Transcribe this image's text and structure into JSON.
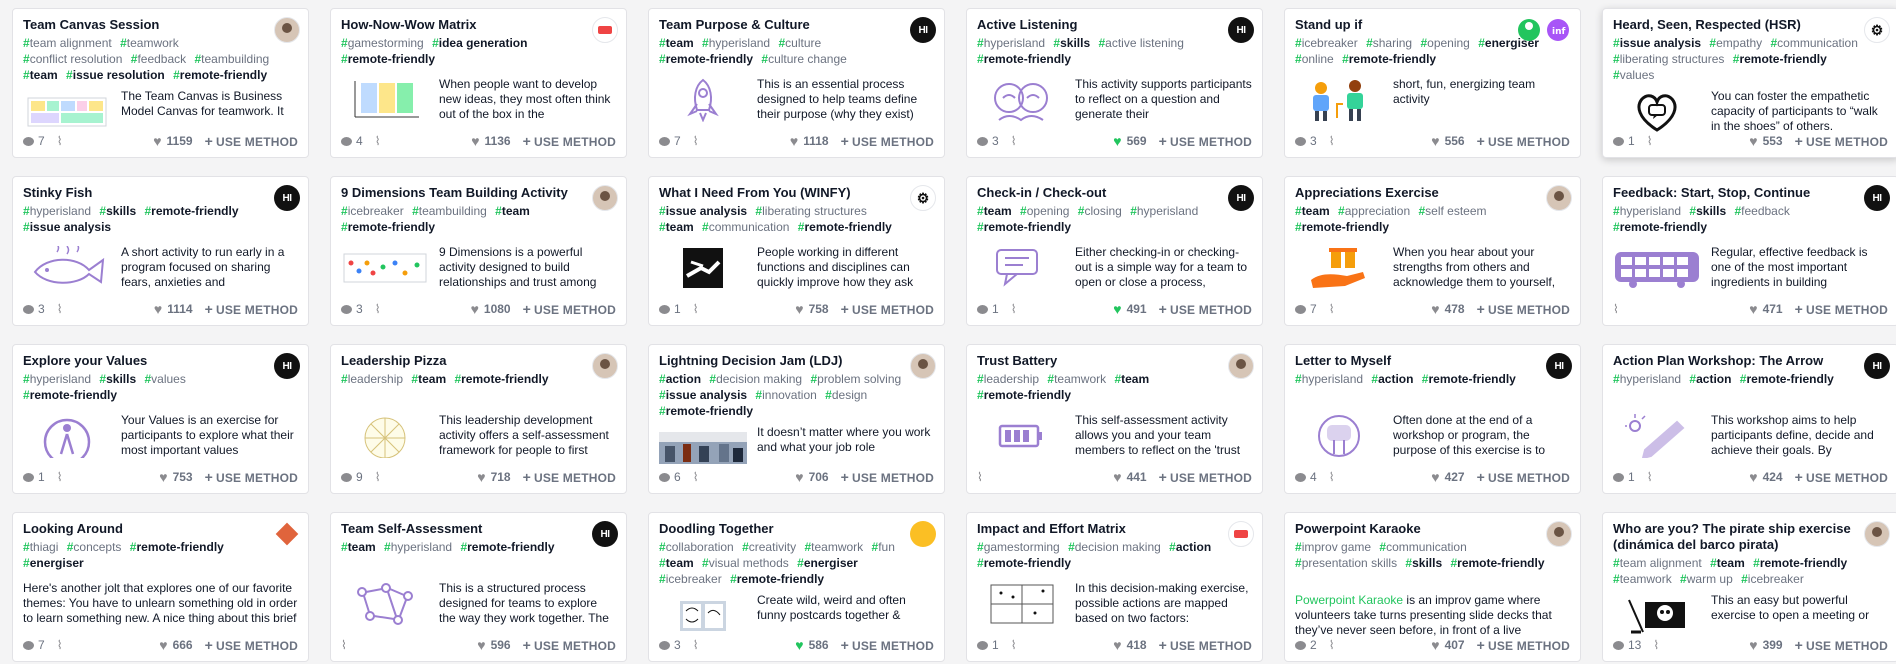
{
  "colors": {
    "accent": "#22c55e",
    "illustration": "#9b7fd1",
    "orange": "#f59e0b"
  },
  "cards": [
    {
      "title": "Team Canvas Session",
      "author": "person",
      "tags": [
        [
          "team alignment",
          0
        ],
        [
          "teamwork",
          0
        ],
        [
          "conflict resolution",
          0
        ],
        [
          "feedback",
          0
        ],
        [
          "teambuilding",
          0
        ],
        [
          "team",
          1
        ],
        [
          "issue resolution",
          1
        ],
        [
          "remote-friendly",
          1
        ]
      ],
      "desc": "The Team Canvas is Business Model Canvas for teamwork. It",
      "illus": "canvas-image",
      "comments": "7",
      "likes": "1159",
      "liked": false,
      "use": "USE METHOD"
    },
    {
      "title": "How-Now-Wow Matrix",
      "author": "badge",
      "tags": [
        [
          "gamestorming",
          0
        ],
        [
          "idea generation",
          1
        ],
        [
          "remote-friendly",
          1
        ]
      ],
      "desc": "When people want to develop new ideas, they most often think out of the box in the",
      "illus": "matrix-image",
      "comments": "4",
      "likes": "1136",
      "liked": false,
      "use": "USE METHOD"
    },
    {
      "title": "Team Purpose & Culture",
      "author": "hi",
      "tags": [
        [
          "team",
          1
        ],
        [
          "hyperisland",
          0
        ],
        [
          "culture",
          0
        ],
        [
          "remote-friendly",
          1
        ],
        [
          "culture change",
          0
        ]
      ],
      "desc": "This is an essential process designed to help teams define their purpose (why they exist)",
      "illus": "rocket-icon",
      "comments": "7",
      "likes": "1118",
      "liked": false,
      "use": "USE METHOD"
    },
    {
      "title": "Active Listening",
      "author": "hi",
      "tags": [
        [
          "hyperisland",
          0
        ],
        [
          "skills",
          1
        ],
        [
          "active listening",
          0
        ],
        [
          "remote-friendly",
          1
        ]
      ],
      "desc": "This activity supports participants to reflect on a question and generate their",
      "illus": "heads-icon",
      "comments": "3",
      "likes": "569",
      "liked": true,
      "use": "USE METHOD"
    },
    {
      "title": "Stand up if",
      "author": "logos",
      "tags": [
        [
          "icebreaker",
          0
        ],
        [
          "sharing",
          0
        ],
        [
          "opening",
          0
        ],
        [
          "energiser",
          1
        ],
        [
          "online",
          0
        ],
        [
          "remote-friendly",
          1
        ]
      ],
      "desc": "short, fun, energizing team activity",
      "illus": "people-icon",
      "comments": "3",
      "likes": "556",
      "liked": false,
      "use": "USE METHOD"
    },
    {
      "title": "Heard, Seen, Respected (HSR)",
      "author": "gift",
      "tags": [
        [
          "issue analysis",
          1
        ],
        [
          "empathy",
          0
        ],
        [
          "communication",
          0
        ],
        [
          "liberating structures",
          0
        ],
        [
          "remote-friendly",
          1
        ],
        [
          "values",
          0
        ]
      ],
      "desc": "You can foster the empathetic capacity of participants to “walk in the shoes” of others.",
      "illus": "heart-icon",
      "comments": "1",
      "likes": "553",
      "liked": false,
      "use": "USE METHOD"
    },
    {
      "title": "Stinky Fish",
      "author": "hi",
      "tags": [
        [
          "hyperisland",
          0
        ],
        [
          "skills",
          1
        ],
        [
          "remote-friendly",
          1
        ],
        [
          "issue analysis",
          1
        ]
      ],
      "desc": "A short activity to run early in a program focused on sharing fears, anxieties and",
      "illus": "fish-icon",
      "comments": "3",
      "likes": "1114",
      "liked": false,
      "use": "USE METHOD"
    },
    {
      "title": "9 Dimensions Team Building Activity",
      "author": "person",
      "tags": [
        [
          "icebreaker",
          0
        ],
        [
          "teambuilding",
          0
        ],
        [
          "team",
          1
        ],
        [
          "remote-friendly",
          1
        ]
      ],
      "desc": "9 Dimensions is a powerful activity designed to build relationships and trust among",
      "illus": "dimensions-image",
      "comments": "3",
      "likes": "1080",
      "liked": false,
      "use": "USE METHOD"
    },
    {
      "title": "What I Need From You (WINFY)",
      "author": "gift",
      "tags": [
        [
          "issue analysis",
          1
        ],
        [
          "liberating structures",
          0
        ],
        [
          "team",
          1
        ],
        [
          "communication",
          0
        ],
        [
          "remote-friendly",
          1
        ]
      ],
      "desc": "People working in different functions and disciplines can quickly improve how they ask",
      "illus": "hands-image",
      "comments": "1",
      "likes": "758",
      "liked": false,
      "use": "USE METHOD"
    },
    {
      "title": "Check-in / Check-out",
      "author": "hi",
      "tags": [
        [
          "team",
          1
        ],
        [
          "opening",
          0
        ],
        [
          "closing",
          0
        ],
        [
          "hyperisland",
          0
        ],
        [
          "remote-friendly",
          1
        ]
      ],
      "desc": "Either checking-in or checking-out is a simple way for a team to open or close a process,",
      "illus": "chat-icon",
      "comments": "1",
      "likes": "491",
      "liked": true,
      "use": "USE METHOD"
    },
    {
      "title": "Appreciations Exercise",
      "author": "person",
      "tags": [
        [
          "team",
          1
        ],
        [
          "appreciation",
          0
        ],
        [
          "self esteem",
          0
        ],
        [
          "remote-friendly",
          1
        ]
      ],
      "desc": "When you hear about your strengths from others and acknowledge them to yourself,",
      "illus": "gift-hand-icon",
      "comments": "7",
      "likes": "478",
      "liked": false,
      "use": "USE METHOD"
    },
    {
      "title": "Feedback: Start, Stop, Continue",
      "author": "hi",
      "tags": [
        [
          "hyperisland",
          0
        ],
        [
          "skills",
          1
        ],
        [
          "feedback",
          0
        ],
        [
          "remote-friendly",
          1
        ]
      ],
      "desc": "Regular, effective feedback is one of the most important ingredients in building",
      "illus": "bus-icon",
      "comments": "",
      "likes": "471",
      "liked": false,
      "use": "USE METHOD"
    },
    {
      "title": "Explore your Values",
      "author": "hi",
      "tags": [
        [
          "hyperisland",
          0
        ],
        [
          "skills",
          1
        ],
        [
          "values",
          0
        ],
        [
          "remote-friendly",
          1
        ]
      ],
      "desc": "Your Values is an exercise for participants to explore what their most important values",
      "illus": "compass-icon",
      "comments": "1",
      "likes": "753",
      "liked": false,
      "use": "USE METHOD"
    },
    {
      "title": "Leadership Pizza",
      "author": "person",
      "tags": [
        [
          "leadership",
          0
        ],
        [
          "team",
          1
        ],
        [
          "remote-friendly",
          1
        ]
      ],
      "desc": "This leadership development activity offers a self-assessment framework for people to first identify what",
      "illus": "pizza-image",
      "comments": "9",
      "likes": "718",
      "liked": false,
      "use": "USE METHOD"
    },
    {
      "title": "Lightning Decision Jam (LDJ)",
      "author": "person",
      "tags": [
        [
          "action",
          1
        ],
        [
          "decision making",
          0
        ],
        [
          "problem solving",
          0
        ],
        [
          "issue analysis",
          1
        ],
        [
          "innovation",
          0
        ],
        [
          "design",
          0
        ],
        [
          "remote-friendly",
          1
        ]
      ],
      "desc": "It doesn’t matter where you work and what your job role",
      "illus": "room-photo",
      "comments": "6",
      "likes": "706",
      "liked": false,
      "use": "USE METHOD"
    },
    {
      "title": "Trust Battery",
      "author": "person",
      "tags": [
        [
          "leadership",
          0
        ],
        [
          "teamwork",
          0
        ],
        [
          "team",
          1
        ],
        [
          "remote-friendly",
          1
        ]
      ],
      "desc": "This self-assessment activity allows you and your team members to reflect on the 'trust",
      "illus": "battery-icon",
      "comments": "",
      "likes": "441",
      "liked": false,
      "use": "USE METHOD"
    },
    {
      "title": "Letter to Myself",
      "author": "hi",
      "tags": [
        [
          "hyperisland",
          0
        ],
        [
          "action",
          1
        ],
        [
          "remote-friendly",
          1
        ]
      ],
      "desc": "Often done at the end of a workshop or program, the purpose of this exercise is to support participants in",
      "illus": "fist-icon",
      "comments": "4",
      "likes": "427",
      "liked": false,
      "use": "USE METHOD"
    },
    {
      "title": "Action Plan Workshop: The Arrow",
      "author": "hi",
      "tags": [
        [
          "hyperisland",
          0
        ],
        [
          "action",
          1
        ],
        [
          "remote-friendly",
          1
        ]
      ],
      "desc": "This workshop aims to help participants define, decide and achieve their goals. By supporting participants to",
      "illus": "pencil-icon",
      "comments": "1",
      "likes": "424",
      "liked": false,
      "use": "USE METHOD"
    },
    {
      "title": "Looking Around",
      "author": "diamond",
      "tags": [
        [
          "thiagi",
          0
        ],
        [
          "concepts",
          0
        ],
        [
          "remote-friendly",
          1
        ],
        [
          "energiser",
          1
        ]
      ],
      "desc": "Here's another jolt that explores one of our favorite themes: You have to unlearn something old in order to learn something new. A nice thing about this brief",
      "illus": "",
      "comments": "7",
      "likes": "666",
      "liked": false,
      "use": "USE METHOD"
    },
    {
      "title": "Team Self-Assessment",
      "author": "hi",
      "tags": [
        [
          "team",
          1
        ],
        [
          "hyperisland",
          0
        ],
        [
          "remote-friendly",
          1
        ]
      ],
      "desc": "This is a structured process designed for teams to explore the way they work together. The tight structure supports",
      "illus": "network-icon",
      "comments": "",
      "likes": "596",
      "liked": false,
      "use": "USE METHOD"
    },
    {
      "title": "Doodling Together",
      "author": "yellow",
      "tags": [
        [
          "collaboration",
          0
        ],
        [
          "creativity",
          0
        ],
        [
          "teamwork",
          0
        ],
        [
          "fun",
          0
        ],
        [
          "team",
          1
        ],
        [
          "visual methods",
          0
        ],
        [
          "energiser",
          1
        ],
        [
          "icebreaker",
          0
        ],
        [
          "remote-friendly",
          1
        ]
      ],
      "desc": "Create wild, weird and often funny postcards together &",
      "illus": "doodle-photo",
      "comments": "3",
      "likes": "586",
      "liked": true,
      "use": "USE METHOD"
    },
    {
      "title": "Impact and Effort Matrix",
      "author": "badge",
      "tags": [
        [
          "gamestorming",
          0
        ],
        [
          "decision making",
          0
        ],
        [
          "action",
          1
        ],
        [
          "remote-friendly",
          1
        ]
      ],
      "desc": "In this decision-making exercise, possible actions are mapped based on two factors:",
      "illus": "effort-image",
      "comments": "1",
      "likes": "418",
      "liked": false,
      "use": "USE METHOD"
    },
    {
      "title": "Powerpoint Karaoke",
      "author": "person",
      "tags": [
        [
          "improv game",
          0
        ],
        [
          "communication",
          0
        ],
        [
          "presentation skills",
          0
        ],
        [
          "skills",
          1
        ],
        [
          "remote-friendly",
          1
        ]
      ],
      "desc_link": "Powerpoint Karaoke",
      "desc": " is an improv game where volunteers take turns presenting slide decks that they’ve never seen before, in front of a live audience.",
      "illus": "",
      "comments": "2",
      "likes": "407",
      "liked": false,
      "use": "USE METHOD"
    },
    {
      "title": "Who are you? The pirate ship exercise (dinámica del barco pirata)",
      "author": "person",
      "tags": [
        [
          "team alignment",
          0
        ],
        [
          "team",
          1
        ],
        [
          "remote-friendly",
          1
        ],
        [
          "teamwork",
          0
        ],
        [
          "warm up",
          0
        ],
        [
          "icebreaker",
          0
        ]
      ],
      "desc": "This an easy but powerful exercise to open a meeting or",
      "illus": "pirate-flag-icon",
      "comments": "13",
      "likes": "399",
      "liked": false,
      "use": "USE METHOD"
    }
  ],
  "author_label": "HI"
}
